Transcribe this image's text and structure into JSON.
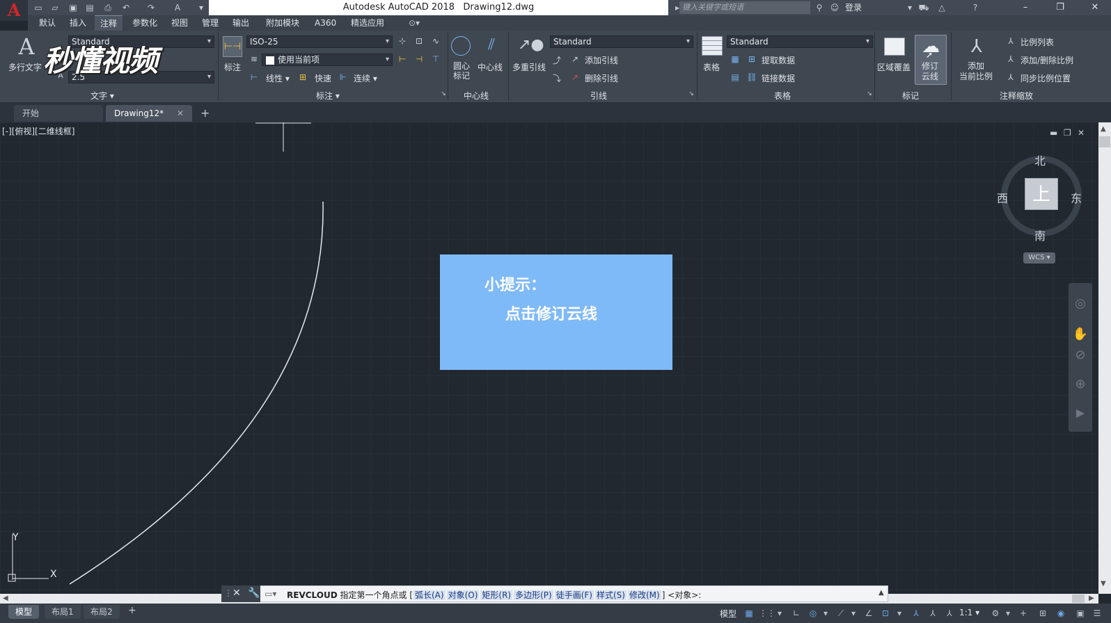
{
  "titlebar": {
    "app_name": "Autodesk AutoCAD 2018",
    "file_name": "Drawing12.dwg",
    "search_placeholder": "键入关键字或短语",
    "login_label": "登录",
    "logo_letter": "A"
  },
  "ribbon_tabs": [
    "默认",
    "插入",
    "注释",
    "参数化",
    "视图",
    "管理",
    "输出",
    "附加模块",
    "A360",
    "精选应用"
  ],
  "active_ribbon_tab": "注释",
  "panels": {
    "text": {
      "title": "文字",
      "big_button": "多行文字",
      "style_value": "Standard",
      "height_value": "2.5"
    },
    "dimension": {
      "title": "标注",
      "big_button": "标注",
      "style_value": "ISO-25",
      "layer_value": "使用当前项",
      "linear_label": "线性",
      "quick_label": "快速",
      "continue_label": "连续"
    },
    "centerline": {
      "title": "中心线",
      "center_mark_label": "圆心\n标记",
      "centerline_label": "中心线"
    },
    "leader": {
      "title": "引线",
      "big_button": "多重引线",
      "style_value": "Standard",
      "add_leader": "添加引线",
      "remove_leader": "删除引线"
    },
    "table": {
      "title": "表格",
      "big_button": "表格",
      "style_value": "Standard",
      "extract_data": "提取数据",
      "link_data": "链接数据"
    },
    "markup": {
      "title": "标记",
      "wipeout_label": "区域覆盖",
      "revcloud_label_1": "修订",
      "revcloud_label_2": "云线"
    },
    "annotation_scaling": {
      "title": "注释缩放",
      "add_current_scale_1": "添加",
      "add_current_scale_2": "当前比例",
      "scale_list": "比例列表",
      "add_delete_scales": "添加/删除比例",
      "sync_scale_positions": "同步比例位置"
    }
  },
  "doc_tabs": [
    {
      "label": "开始"
    },
    {
      "label": "Drawing12*"
    }
  ],
  "viewport_label": "[-][俯视][二维线框]",
  "tip": {
    "title": "小提示：",
    "body": "点击修订云线"
  },
  "viewcube": {
    "top_face": "上",
    "north": "北",
    "south": "南",
    "east": "东",
    "west": "西",
    "wcs": "WCS"
  },
  "ucs": {
    "x_label": "X",
    "y_label": "Y"
  },
  "command_line": {
    "command": "REVCLOUD",
    "prompt": "指定第一个角点或",
    "options": [
      "弧长(A)",
      "对象(O)",
      "矩形(R)",
      "多边形(P)",
      "徒手画(F)",
      "样式(S)",
      "修改(M)"
    ],
    "default_option": "<对象>:"
  },
  "layout_tabs": [
    "模型",
    "布局1",
    "布局2"
  ],
  "statusbar": {
    "model_label": "模型",
    "scale_label": "1:1"
  },
  "watermark": "秒懂视频",
  "colors": {
    "canvas_bg": "#212830",
    "tip_bg": "#7fbaf8",
    "ribbon_bg": "#3f4751",
    "logo_red": "#d4262b"
  }
}
